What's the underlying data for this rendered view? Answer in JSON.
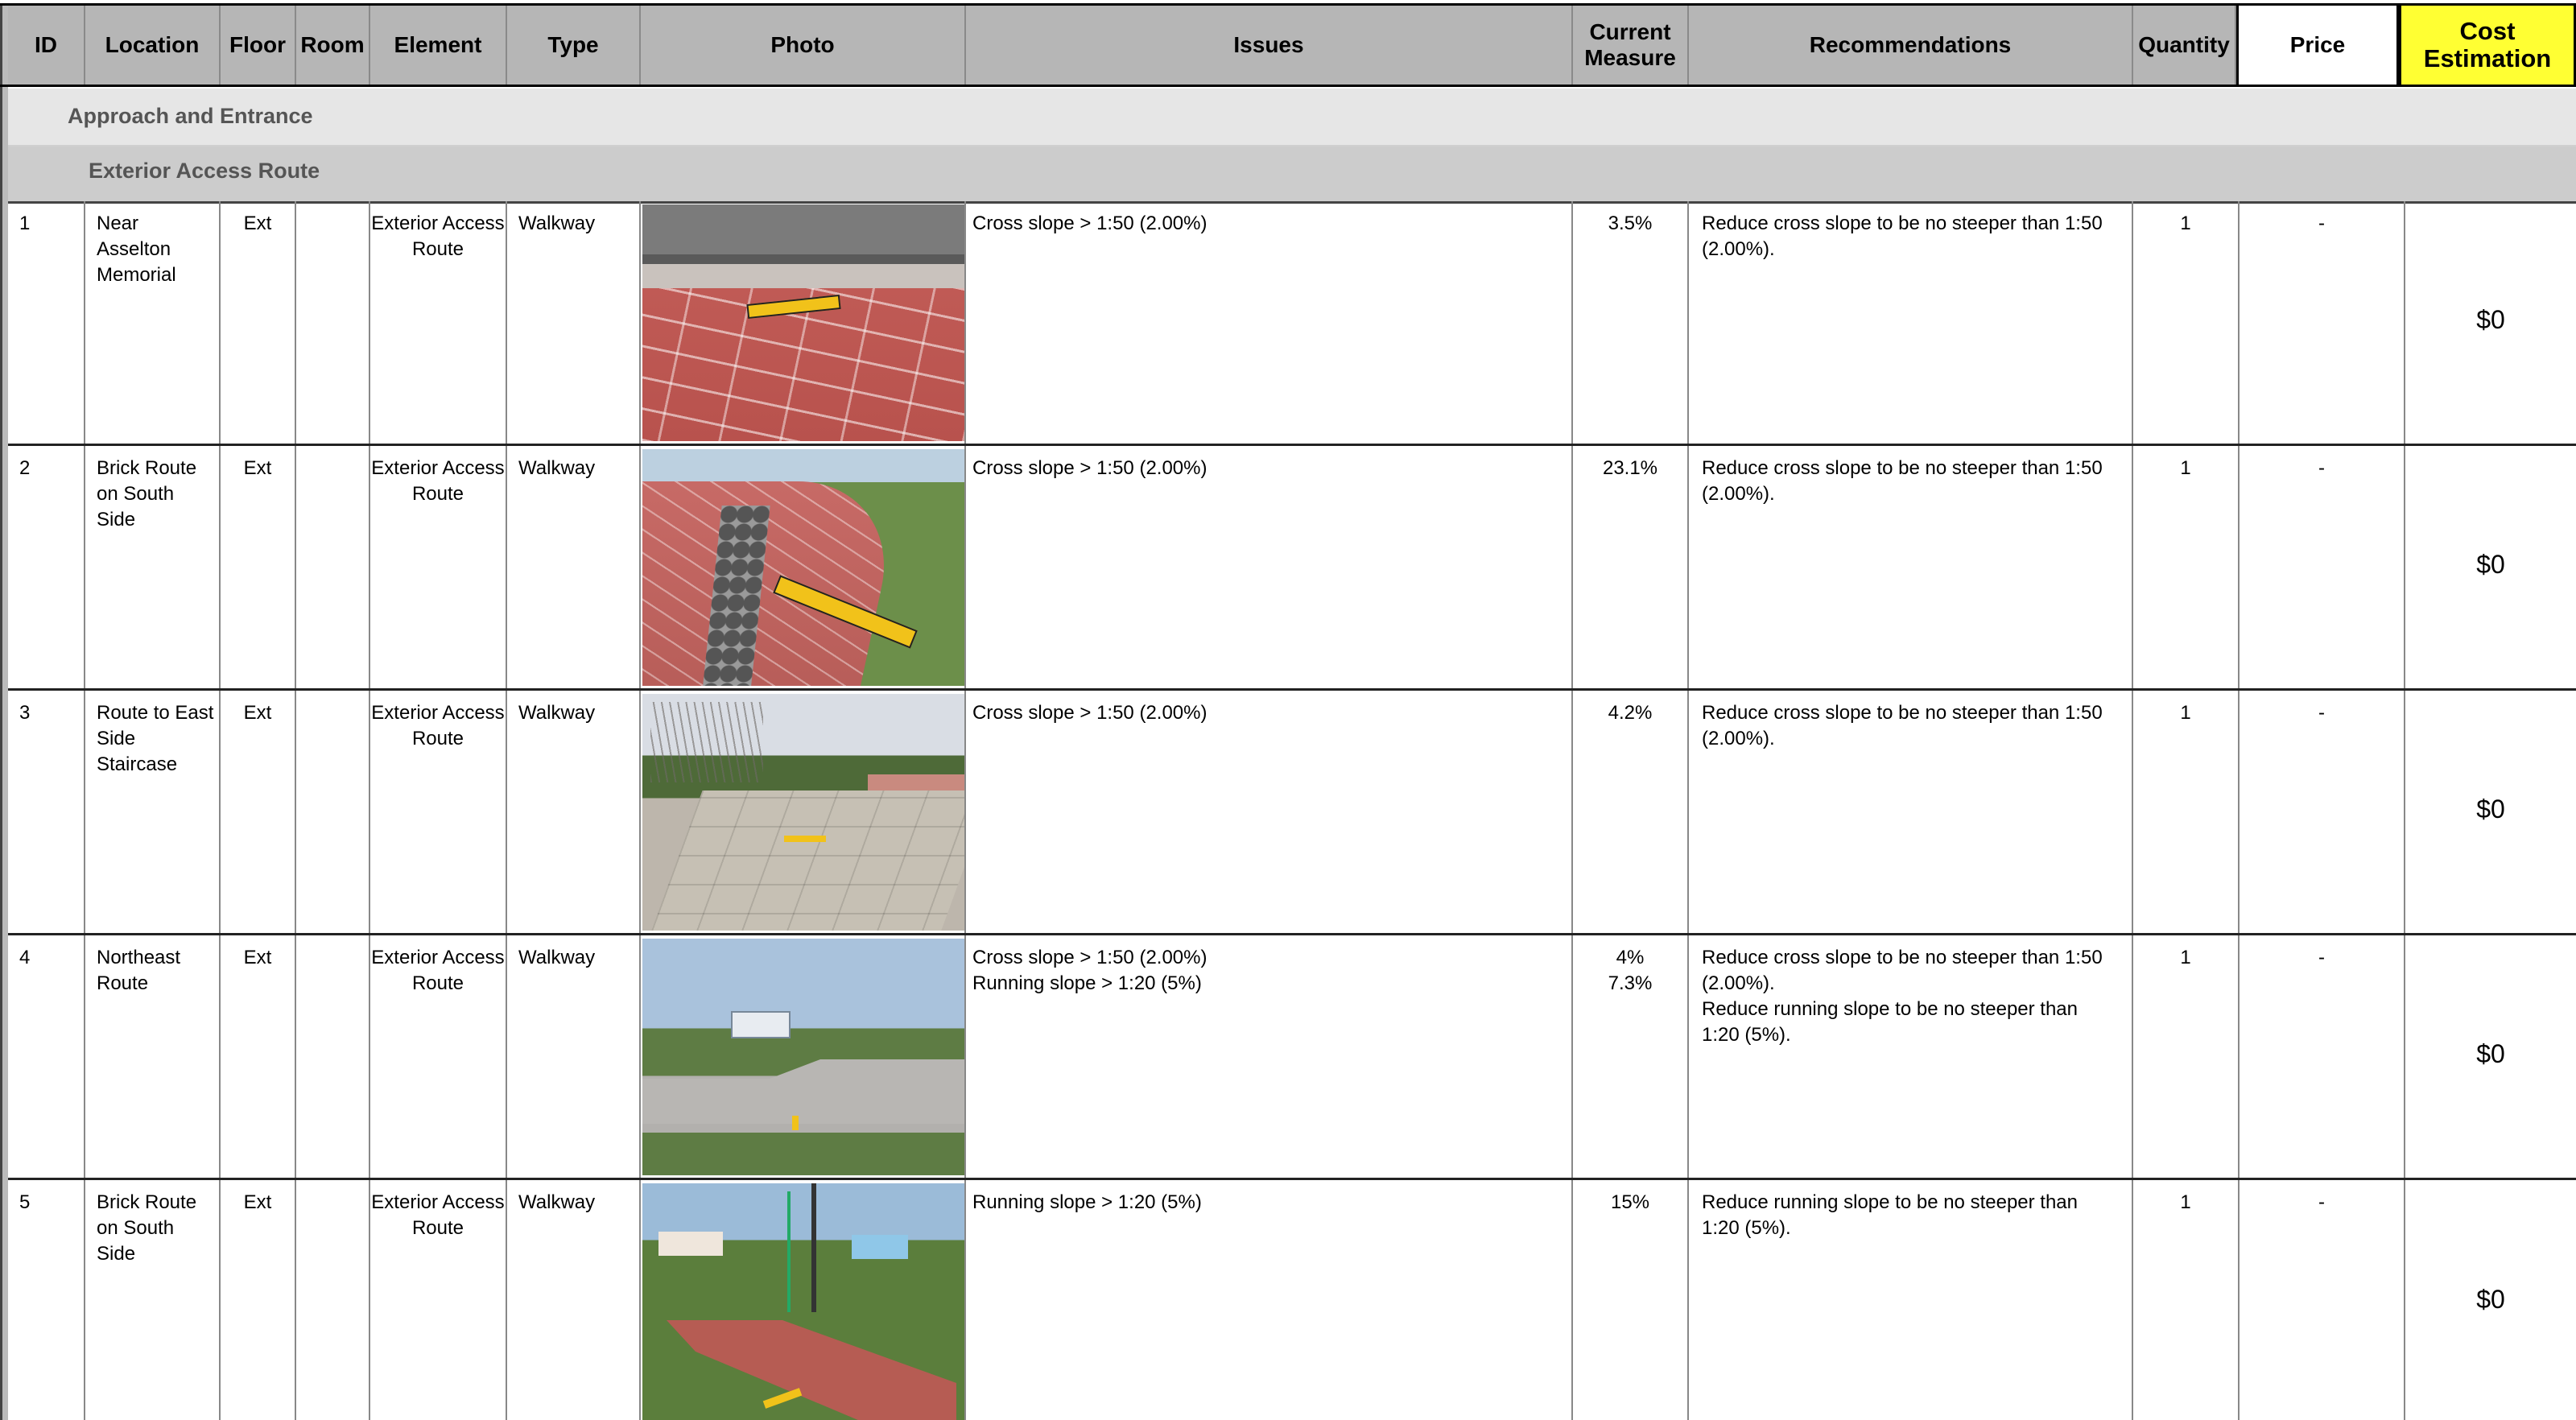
{
  "columns": {
    "id": "ID",
    "location": "Location",
    "floor": "Floor",
    "room": "Room",
    "element": "Element",
    "type": "Type",
    "photo": "Photo",
    "issues": "Issues",
    "current_measure": "Current Measure",
    "recommendations": "Recommendations",
    "quantity": "Quantity",
    "price": "Price",
    "cost_estimation": "Cost Estimation"
  },
  "groups": {
    "section": "Approach and Entrance",
    "subsection": "Exterior Access Route"
  },
  "rows": [
    {
      "id": "1",
      "location": "Near Asselton Memorial",
      "floor": "Ext",
      "room": "",
      "element": "Exterior Access Route",
      "type": "Walkway",
      "photo_desc": "brick-walkway-level",
      "issues": [
        "Cross slope > 1:50 (2.00%)"
      ],
      "current": [
        "3.5%"
      ],
      "recommendations": [
        "Reduce cross slope to be no steeper than 1:50 (2.00%)."
      ],
      "quantity": "1",
      "price": "-",
      "cost": "$0"
    },
    {
      "id": "2",
      "location": "Brick Route on South Side",
      "floor": "Ext",
      "room": "",
      "element": "Exterior Access Route",
      "type": "Walkway",
      "photo_desc": "brick-path-stones-level",
      "issues": [
        "Cross slope > 1:50 (2.00%)"
      ],
      "current": [
        "23.1%"
      ],
      "recommendations": [
        "Reduce cross slope to be no steeper than 1:50 (2.00%)."
      ],
      "quantity": "1",
      "price": "-",
      "cost": "$0"
    },
    {
      "id": "3",
      "location": "Route to East Side Staircase",
      "floor": "Ext",
      "room": "",
      "element": "Exterior Access Route",
      "type": "Walkway",
      "photo_desc": "concrete-walkway-park",
      "issues": [
        "Cross slope > 1:50 (2.00%)"
      ],
      "current": [
        "4.2%"
      ],
      "recommendations": [
        "Reduce cross slope to be no steeper than 1:50 (2.00%)."
      ],
      "quantity": "1",
      "price": "-",
      "cost": "$0"
    },
    {
      "id": "4",
      "location": "Northeast Route",
      "floor": "Ext",
      "room": "",
      "element": "Exterior Access Route",
      "type": "Walkway",
      "photo_desc": "concrete-route-harbor",
      "issues": [
        "Cross slope > 1:50 (2.00%)",
        "Running slope > 1:20 (5%)"
      ],
      "current": [
        "4%",
        "7.3%"
      ],
      "recommendations": [
        "Reduce cross slope to be no steeper than 1:50 (2.00%).",
        "Reduce running slope to be no steeper than 1:20 (5%)."
      ],
      "quantity": "1",
      "price": "-",
      "cost": "$0"
    },
    {
      "id": "5",
      "location": "Brick Route on South Side",
      "floor": "Ext",
      "room": "",
      "element": "Exterior Access Route",
      "type": "Walkway",
      "photo_desc": "brick-route-lawn-poles",
      "issues": [
        "Running slope > 1:20 (5%)"
      ],
      "current": [
        "15%"
      ],
      "recommendations": [
        "Reduce running slope to be no steeper than 1:20 (5%)."
      ],
      "quantity": "1",
      "price": "-",
      "cost": "$0"
    }
  ]
}
